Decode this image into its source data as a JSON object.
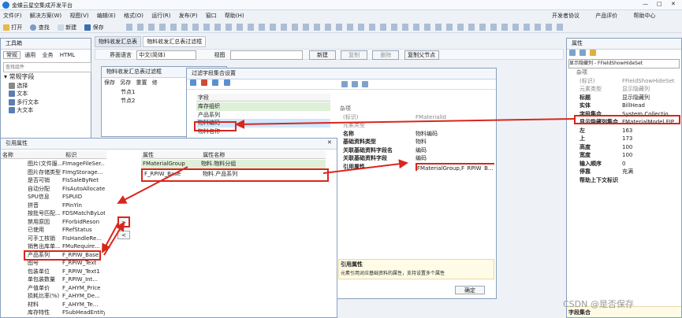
{
  "app_title": "金蝶云星空集成开发平台",
  "menu": [
    "文件(F)",
    "解决方案(W)",
    "视图(V)",
    "编辑(E)",
    "格式(O)",
    "运行(R)",
    "发布(P)",
    "窗口",
    "帮助(H)"
  ],
  "menu_right": [
    "开发者协议",
    "产品评价",
    "帮助中心"
  ],
  "toolbar": [
    "打开",
    "查找",
    "新建",
    "保存"
  ],
  "toolbox": {
    "title": "工具箱",
    "tabs": [
      "常规",
      "通用",
      "业务",
      "HTML"
    ],
    "search_placeholder": "查找组件",
    "group": "常规字段",
    "items": [
      "选择",
      "文本",
      "多行文本",
      "大文本"
    ]
  },
  "doc_tabs": [
    "物料收发汇总表",
    "物料收发汇总表过滤框"
  ],
  "lang_bar": {
    "label": "界面语言",
    "value": "中文(简体)",
    "view_label": "视图",
    "buttons": [
      "新建",
      "复制",
      "删除",
      "复制父节点"
    ]
  },
  "filter_win": {
    "title": "物料收发汇总表过滤框",
    "toolbar": [
      "保存",
      "另存",
      "重置",
      "修"
    ],
    "tree": [
      "节点1",
      "节点2"
    ]
  },
  "fieldset_dialog": {
    "title": "过滤字段集合设置",
    "column": "字段",
    "rows": [
      "库存组织",
      "产品系列",
      "物料编码",
      "物料名称"
    ],
    "section": "杂项",
    "props": [
      [
        "(标识)",
        "FMaterialId"
      ],
      [
        "元素类型",
        ""
      ],
      [
        "名称",
        "物料编码"
      ],
      [
        "基础资料类型",
        "物料"
      ],
      [
        "关联基础资料字段名",
        "编码"
      ],
      [
        "关联基础资料字段",
        "编码"
      ],
      [
        "引用属性",
        "FMaterialGroup,F_RPIW_B..."
      ]
    ],
    "desc_title": "引用属性",
    "desc": "元素引用对应基础资料的属性，支持设置多个属性",
    "ok": "确定"
  },
  "ref_dialog": {
    "title": "引用属性",
    "left_headers": [
      "名称",
      "标识"
    ],
    "left_rows": [
      [
        "图片(文件服...",
        "FImageFileSer..."
      ],
      [
        "图片存储类型",
        "FImgStorage..."
      ],
      [
        "是否可销",
        "FIsSaleByNet"
      ],
      [
        "自动分配",
        "FIsAutoAllocate"
      ],
      [
        "SPU信息",
        "FSPUID"
      ],
      [
        "拼音",
        "FPinYin"
      ],
      [
        "按批号匹配...",
        "FDSMatchByLot"
      ],
      [
        "禁用原因",
        "FForbidReson"
      ],
      [
        "已使用",
        "FRefStatus"
      ],
      [
        "可手工核销",
        "FIsHandleRe..."
      ],
      [
        "销售出库单...",
        "FMuRequire..."
      ],
      [
        "产品系列",
        "F_RPIW_Base"
      ],
      [
        "图号",
        "F_RPIW_Text"
      ],
      [
        "包装单位",
        "F_RPIW_Text1"
      ],
      [
        "单包装数量",
        "F_RPIW_Int..."
      ],
      [
        "产值单价",
        "F_AHYM_Price"
      ],
      [
        "损耗比率(%)",
        "F_AHYM_De..."
      ],
      [
        "材料",
        "F_AHYM_Te..."
      ],
      [
        "库存特性",
        "FSubHeadEntity"
      ]
    ],
    "right_headers": [
      "属性",
      "属性名称"
    ],
    "right_rows": [
      [
        "FMaterialGroup",
        "物料.物料分组"
      ],
      [
        "F_RPIW_Base",
        "物料.产品系列"
      ]
    ],
    "add_btn": ">",
    "remove_btn": "<"
  },
  "properties": {
    "title": "属性",
    "selector": "显示隐藏列 - FFieldShowHideSet",
    "section": "杂项",
    "rows": [
      [
        "(标识)",
        "FFieldShowHideSet"
      ],
      [
        "元素类型",
        "显示隐藏列"
      ],
      [
        "标题",
        "显示隐藏列"
      ],
      [
        "实体",
        "BillHead"
      ],
      [
        "字段集合",
        "System.Collectio..."
      ],
      [
        "显示隐藏列集合",
        "FMaterialModel,FIP..."
      ],
      [
        "左",
        "163"
      ],
      [
        "上",
        "173"
      ],
      [
        "高度",
        "100"
      ],
      [
        "宽度",
        "100"
      ],
      [
        "输入顺序",
        "0"
      ],
      [
        "停靠",
        "充满"
      ],
      [
        "帮助上下文标识",
        ""
      ]
    ],
    "footer": "字段集合"
  },
  "watermark": "CSDN @是否保存"
}
